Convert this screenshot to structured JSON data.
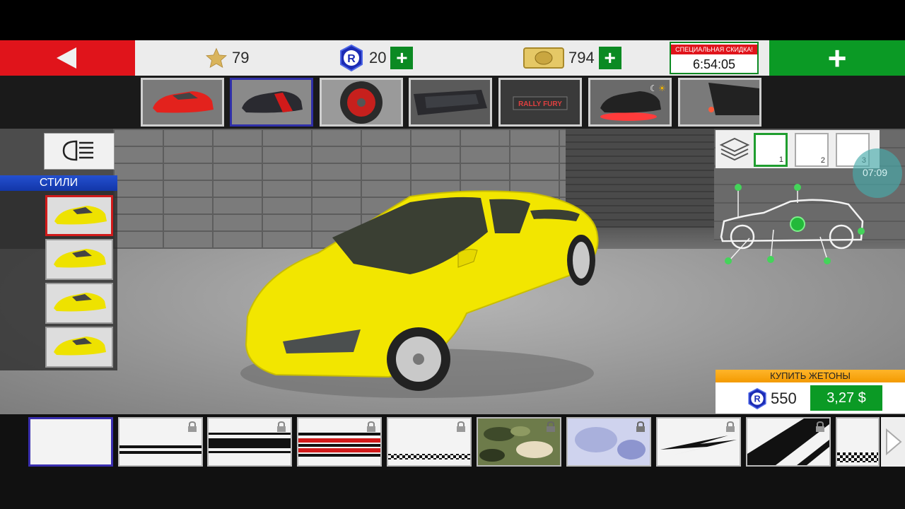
{
  "topbar": {
    "stars": "79",
    "tokens": "20",
    "gold": "794",
    "promo_label": "СПЕЦИАЛЬНАЯ СКИДКА!",
    "promo_timer": "6:54:05",
    "plus_label": "+"
  },
  "categories": [
    {
      "name": "paint",
      "icon": "red-car-icon"
    },
    {
      "name": "styles",
      "icon": "dark-car-red-stripe-icon",
      "selected": true
    },
    {
      "name": "wheels",
      "icon": "wheel-icon"
    },
    {
      "name": "windows",
      "icon": "tinted-windows-icon"
    },
    {
      "name": "plate",
      "icon": "plate-icon",
      "text": "RALLY FURY"
    },
    {
      "name": "neon",
      "icon": "neon-car-icon"
    },
    {
      "name": "spoiler",
      "icon": "spoiler-icon"
    }
  ],
  "left_panel": {
    "styles_label": "СТИЛИ",
    "style_count": 4,
    "selected_index": 0
  },
  "right_panel": {
    "slots": [
      "1",
      "2",
      "3"
    ],
    "active_slot": 0,
    "clock": "07:09"
  },
  "buy": {
    "title": "КУПИТЬ ЖЕТОНЫ",
    "amount": "550",
    "price": "3,27 $"
  },
  "colors": {
    "accent_red": "#e0141b",
    "accent_green": "#0b9a25",
    "selection_blue": "#2f2fa8",
    "car_yellow": "#f2e600"
  }
}
